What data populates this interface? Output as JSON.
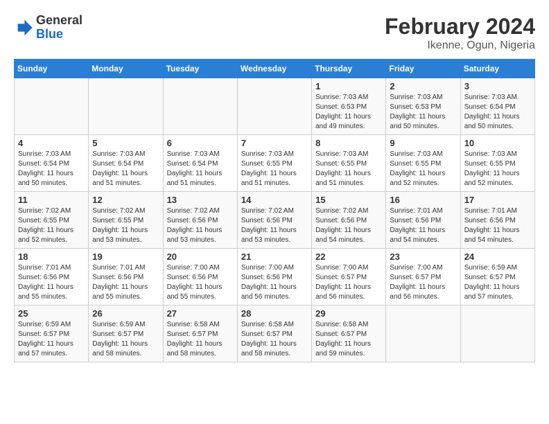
{
  "header": {
    "logo_general": "General",
    "logo_blue": "Blue",
    "main_title": "February 2024",
    "subtitle": "Ikenne, Ogun, Nigeria"
  },
  "columns": [
    "Sunday",
    "Monday",
    "Tuesday",
    "Wednesday",
    "Thursday",
    "Friday",
    "Saturday"
  ],
  "weeks": [
    [
      {
        "day": "",
        "sunrise": "",
        "sunset": "",
        "daylight": ""
      },
      {
        "day": "",
        "sunrise": "",
        "sunset": "",
        "daylight": ""
      },
      {
        "day": "",
        "sunrise": "",
        "sunset": "",
        "daylight": ""
      },
      {
        "day": "",
        "sunrise": "",
        "sunset": "",
        "daylight": ""
      },
      {
        "day": "1",
        "sunrise": "Sunrise: 7:03 AM",
        "sunset": "Sunset: 6:53 PM",
        "daylight": "Daylight: 11 hours and 49 minutes."
      },
      {
        "day": "2",
        "sunrise": "Sunrise: 7:03 AM",
        "sunset": "Sunset: 6:53 PM",
        "daylight": "Daylight: 11 hours and 50 minutes."
      },
      {
        "day": "3",
        "sunrise": "Sunrise: 7:03 AM",
        "sunset": "Sunset: 6:54 PM",
        "daylight": "Daylight: 11 hours and 50 minutes."
      }
    ],
    [
      {
        "day": "4",
        "sunrise": "Sunrise: 7:03 AM",
        "sunset": "Sunset: 6:54 PM",
        "daylight": "Daylight: 11 hours and 50 minutes."
      },
      {
        "day": "5",
        "sunrise": "Sunrise: 7:03 AM",
        "sunset": "Sunset: 6:54 PM",
        "daylight": "Daylight: 11 hours and 51 minutes."
      },
      {
        "day": "6",
        "sunrise": "Sunrise: 7:03 AM",
        "sunset": "Sunset: 6:54 PM",
        "daylight": "Daylight: 11 hours and 51 minutes."
      },
      {
        "day": "7",
        "sunrise": "Sunrise: 7:03 AM",
        "sunset": "Sunset: 6:55 PM",
        "daylight": "Daylight: 11 hours and 51 minutes."
      },
      {
        "day": "8",
        "sunrise": "Sunrise: 7:03 AM",
        "sunset": "Sunset: 6:55 PM",
        "daylight": "Daylight: 11 hours and 51 minutes."
      },
      {
        "day": "9",
        "sunrise": "Sunrise: 7:03 AM",
        "sunset": "Sunset: 6:55 PM",
        "daylight": "Daylight: 11 hours and 52 minutes."
      },
      {
        "day": "10",
        "sunrise": "Sunrise: 7:03 AM",
        "sunset": "Sunset: 6:55 PM",
        "daylight": "Daylight: 11 hours and 52 minutes."
      }
    ],
    [
      {
        "day": "11",
        "sunrise": "Sunrise: 7:02 AM",
        "sunset": "Sunset: 6:55 PM",
        "daylight": "Daylight: 11 hours and 52 minutes."
      },
      {
        "day": "12",
        "sunrise": "Sunrise: 7:02 AM",
        "sunset": "Sunset: 6:55 PM",
        "daylight": "Daylight: 11 hours and 53 minutes."
      },
      {
        "day": "13",
        "sunrise": "Sunrise: 7:02 AM",
        "sunset": "Sunset: 6:56 PM",
        "daylight": "Daylight: 11 hours and 53 minutes."
      },
      {
        "day": "14",
        "sunrise": "Sunrise: 7:02 AM",
        "sunset": "Sunset: 6:56 PM",
        "daylight": "Daylight: 11 hours and 53 minutes."
      },
      {
        "day": "15",
        "sunrise": "Sunrise: 7:02 AM",
        "sunset": "Sunset: 6:56 PM",
        "daylight": "Daylight: 11 hours and 54 minutes."
      },
      {
        "day": "16",
        "sunrise": "Sunrise: 7:01 AM",
        "sunset": "Sunset: 6:56 PM",
        "daylight": "Daylight: 11 hours and 54 minutes."
      },
      {
        "day": "17",
        "sunrise": "Sunrise: 7:01 AM",
        "sunset": "Sunset: 6:56 PM",
        "daylight": "Daylight: 11 hours and 54 minutes."
      }
    ],
    [
      {
        "day": "18",
        "sunrise": "Sunrise: 7:01 AM",
        "sunset": "Sunset: 6:56 PM",
        "daylight": "Daylight: 11 hours and 55 minutes."
      },
      {
        "day": "19",
        "sunrise": "Sunrise: 7:01 AM",
        "sunset": "Sunset: 6:56 PM",
        "daylight": "Daylight: 11 hours and 55 minutes."
      },
      {
        "day": "20",
        "sunrise": "Sunrise: 7:00 AM",
        "sunset": "Sunset: 6:56 PM",
        "daylight": "Daylight: 11 hours and 55 minutes."
      },
      {
        "day": "21",
        "sunrise": "Sunrise: 7:00 AM",
        "sunset": "Sunset: 6:56 PM",
        "daylight": "Daylight: 11 hours and 56 minutes."
      },
      {
        "day": "22",
        "sunrise": "Sunrise: 7:00 AM",
        "sunset": "Sunset: 6:57 PM",
        "daylight": "Daylight: 11 hours and 56 minutes."
      },
      {
        "day": "23",
        "sunrise": "Sunrise: 7:00 AM",
        "sunset": "Sunset: 6:57 PM",
        "daylight": "Daylight: 11 hours and 56 minutes."
      },
      {
        "day": "24",
        "sunrise": "Sunrise: 6:59 AM",
        "sunset": "Sunset: 6:57 PM",
        "daylight": "Daylight: 11 hours and 57 minutes."
      }
    ],
    [
      {
        "day": "25",
        "sunrise": "Sunrise: 6:59 AM",
        "sunset": "Sunset: 6:57 PM",
        "daylight": "Daylight: 11 hours and 57 minutes."
      },
      {
        "day": "26",
        "sunrise": "Sunrise: 6:59 AM",
        "sunset": "Sunset: 6:57 PM",
        "daylight": "Daylight: 11 hours and 58 minutes."
      },
      {
        "day": "27",
        "sunrise": "Sunrise: 6:58 AM",
        "sunset": "Sunset: 6:57 PM",
        "daylight": "Daylight: 11 hours and 58 minutes."
      },
      {
        "day": "28",
        "sunrise": "Sunrise: 6:58 AM",
        "sunset": "Sunset: 6:57 PM",
        "daylight": "Daylight: 11 hours and 58 minutes."
      },
      {
        "day": "29",
        "sunrise": "Sunrise: 6:58 AM",
        "sunset": "Sunset: 6:57 PM",
        "daylight": "Daylight: 11 hours and 59 minutes."
      },
      {
        "day": "",
        "sunrise": "",
        "sunset": "",
        "daylight": ""
      },
      {
        "day": "",
        "sunrise": "",
        "sunset": "",
        "daylight": ""
      }
    ]
  ]
}
